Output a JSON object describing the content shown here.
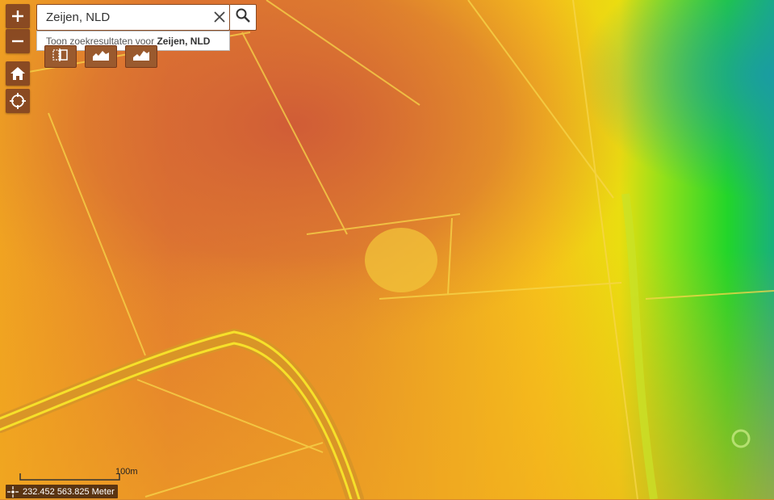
{
  "search": {
    "value": "Zeijen, NLD",
    "suggestion_prefix": "Toon zoekresultaten voor",
    "suggestion_bold": "Zeijen, NLD"
  },
  "zoom": {
    "in_label": "+",
    "out_label": "−"
  },
  "icons": {
    "home": "home-icon",
    "locate": "locate-icon",
    "clear": "close-icon",
    "search": "search-icon",
    "tool1": "layer-compare-icon",
    "tool2": "elevation-profile-icon",
    "tool3": "elevation-profile-icon"
  },
  "scale": {
    "label": "100m"
  },
  "coordinates": {
    "text": "232.452 563.825 Meter"
  },
  "colors": {
    "control_bg": "#8a4a22",
    "tool_bg": "#9a5a2e",
    "coords_bg": "#5a3412"
  }
}
